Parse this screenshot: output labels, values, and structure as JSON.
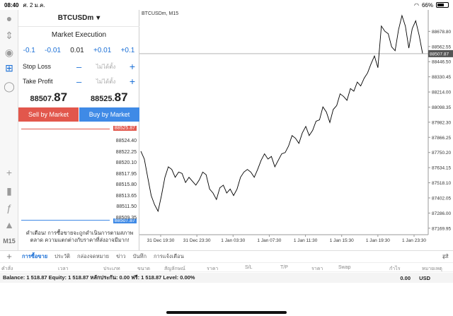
{
  "status": {
    "time": "08:40",
    "date": "ศ. 2 ม.ค.",
    "battery": "66%",
    "battery_level": 0.66
  },
  "panel": {
    "symbol": "BTCUSDm",
    "dropdown": "▾",
    "execution": "Market Execution",
    "volume": {
      "m1": "-0.1",
      "m2": "-0.01",
      "value": "0.01",
      "p2": "+0.01",
      "p1": "+0.1"
    },
    "stop_loss": {
      "label": "Stop Loss",
      "placeholder": "ไม่ได้ตั้ง"
    },
    "take_profit": {
      "label": "Take Profit",
      "placeholder": "ไม่ได้ตั้ง"
    },
    "sell_price": {
      "main": "88507.",
      "big": "87"
    },
    "buy_price": {
      "main": "88525.",
      "big": "87"
    },
    "sell_label": "Sell by Market",
    "buy_label": "Buy by Market",
    "tick_levels": [
      "88524.40",
      "88522.25",
      "88520.10",
      "88517.95",
      "88515.80",
      "88513.65",
      "88511.50",
      "88509.35"
    ],
    "ask_tag": "88525.87",
    "bid_tag": "88507.87",
    "warning": "คำเตือน! การซื้อขายจะถูกดำเนินการตามสภาพตลาด ความแตกต่างกับราคาที่ส่งอาจมีมาก!"
  },
  "left_toolbar": {
    "timeframe": "M15"
  },
  "chart": {
    "title": "BTCUSDm, M15",
    "price_tag": "88507.87",
    "colors": {
      "line": "#000000",
      "grid": "#e3e3e3",
      "bid": "#888888"
    }
  },
  "chart_data": {
    "type": "line",
    "title": "BTCUSDm, M15",
    "x_ticks": [
      "31 Dec 19:30",
      "31 Dec 23:30",
      "1 Jan 03:30",
      "1 Jan 07:30",
      "1 Jan 11:30",
      "1 Jan 15:30",
      "1 Jan 19:30",
      "1 Jan 23:30"
    ],
    "y_ticks": [
      88678.8,
      88562.55,
      88446.5,
      88330.45,
      88214.0,
      88098.35,
      87982.3,
      87866.25,
      87750.2,
      87634.15,
      87518.1,
      87402.05,
      87286.0,
      87169.95
    ],
    "ylim": [
      87120,
      88800
    ],
    "values": [
      87760,
      87700,
      87560,
      87420,
      87350,
      87300,
      87420,
      87560,
      87640,
      87620,
      87560,
      87600,
      87590,
      87520,
      87560,
      87530,
      87500,
      87540,
      87600,
      87580,
      87470,
      87440,
      87390,
      87480,
      87500,
      87440,
      87470,
      87420,
      87470,
      87560,
      87600,
      87620,
      87600,
      87560,
      87620,
      87690,
      87740,
      87700,
      87720,
      87640,
      87690,
      87740,
      87750,
      87800,
      87880,
      87860,
      87820,
      87900,
      87950,
      87880,
      87920,
      87990,
      88000,
      88100,
      88060,
      87980,
      88080,
      88110,
      88200,
      88180,
      88150,
      88240,
      88220,
      88290,
      88260,
      88320,
      88360,
      88430,
      88490,
      88400,
      88720,
      88680,
      88660,
      88560,
      88530,
      88690,
      88800,
      88720,
      88550,
      88700,
      88760,
      88650,
      88510
    ],
    "last_price": 88507.87
  },
  "bottom": {
    "tabs": [
      "การซื้อขาย",
      "ประวัติ",
      "กล่องจดหมาย",
      "ข่าว",
      "บันทึก",
      "การแจ้งเตือน"
    ],
    "columns": [
      "คำสั่ง",
      "เวลา",
      "ประเภท",
      "ขนาด",
      "สัญลักษณ์",
      "ราคา",
      "S/L",
      "T/P",
      "ราคา",
      "Swap",
      "กำไร",
      "หมายเหตุ"
    ],
    "balance_line": "Balance: 1 518.87 Equity: 1 518.87 หลักประกัน: 0.00 ฟรี: 1 518.87 Level: 0.00%",
    "profit_total": "0.00",
    "currency": "USD"
  }
}
